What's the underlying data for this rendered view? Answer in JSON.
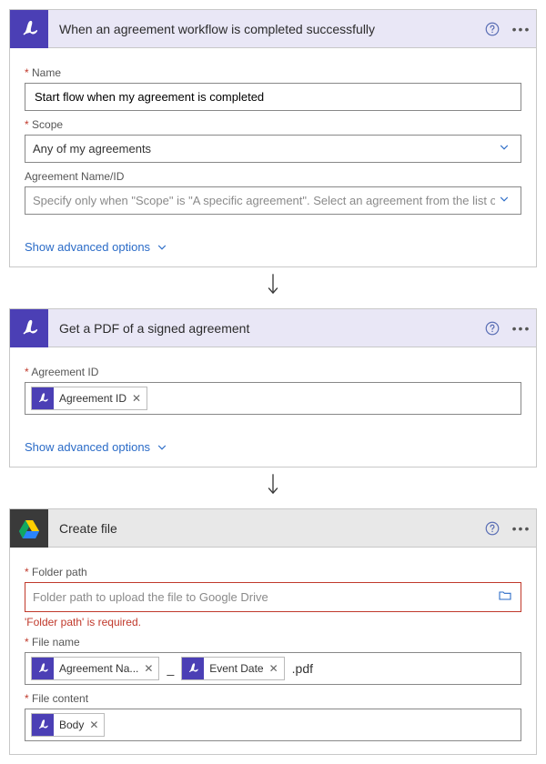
{
  "step1": {
    "title": "When an agreement workflow is completed successfully",
    "name_label": "Name",
    "name_value": "Start flow when my agreement is completed",
    "scope_label": "Scope",
    "scope_value": "Any of my agreements",
    "agid_label": "Agreement Name/ID",
    "agid_placeholder": "Specify only when \"Scope\" is \"A specific agreement\". Select an agreement from the list or enter th",
    "adv": "Show advanced options"
  },
  "step2": {
    "title": "Get a PDF of a signed agreement",
    "agid_label": "Agreement ID",
    "token1": "Agreement ID",
    "adv": "Show advanced options"
  },
  "step3": {
    "title": "Create file",
    "folder_label": "Folder path",
    "folder_placeholder": "Folder path to upload the file to Google Drive",
    "folder_err": "'Folder path' is required.",
    "fname_label": "File name",
    "fname_tok1": "Agreement Na...",
    "fname_sep": "_",
    "fname_tok2": "Event Date",
    "fname_suffix": ".pdf",
    "fcontent_label": "File content",
    "fcontent_tok": "Body"
  }
}
